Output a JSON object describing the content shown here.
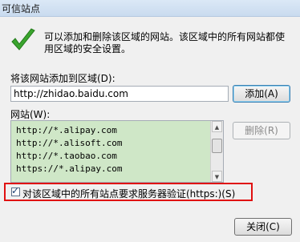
{
  "window": {
    "title": "可信站点"
  },
  "icons": {
    "checkmark": "green-checkmark-icon",
    "scroll_up": "arrow-up-icon",
    "scroll_down": "arrow-down-icon"
  },
  "description": "可以添加和删除该区域的网站。该区域中的所有网站都使用区域的安全设置。",
  "add_label": "将该网站添加到区域(D):",
  "url_input": {
    "value": "http://zhidao.baidu.com"
  },
  "add_button": "添加(A)",
  "sites_label": "网站(W):",
  "sites": [
    "http://*.alipay.com",
    "http://*.alisoft.com",
    "http://*.taobao.com",
    "https://*.alipay.com"
  ],
  "remove_button": "删除(R)",
  "require_https": {
    "label": "对该区域中的所有站点要求服务器验证(https:)(S)",
    "checked": true
  },
  "close_button": "关闭(C)",
  "colors": {
    "list_bg": "#cfe7c7",
    "highlight": "#e01010",
    "check": "#3aa52e"
  }
}
